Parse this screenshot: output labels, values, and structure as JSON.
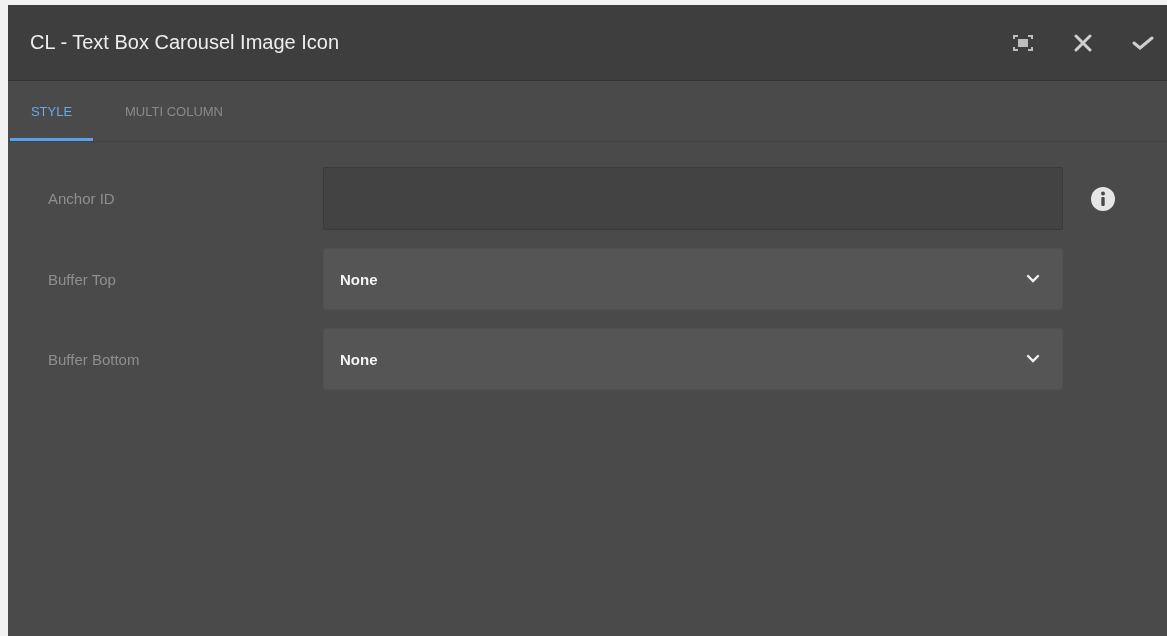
{
  "dialog": {
    "title": "CL - Text Box Carousel Image Icon"
  },
  "tabs": [
    {
      "label": "STYLE",
      "selected": true
    },
    {
      "label": "MULTI COLUMN",
      "selected": false
    }
  ],
  "fields": [
    {
      "kind": "text",
      "label": "Anchor ID",
      "info": true
    },
    {
      "kind": "select",
      "label": "Buffer Top",
      "value": "None"
    },
    {
      "kind": "select",
      "label": "Buffer Bottom",
      "value": "None"
    }
  ]
}
